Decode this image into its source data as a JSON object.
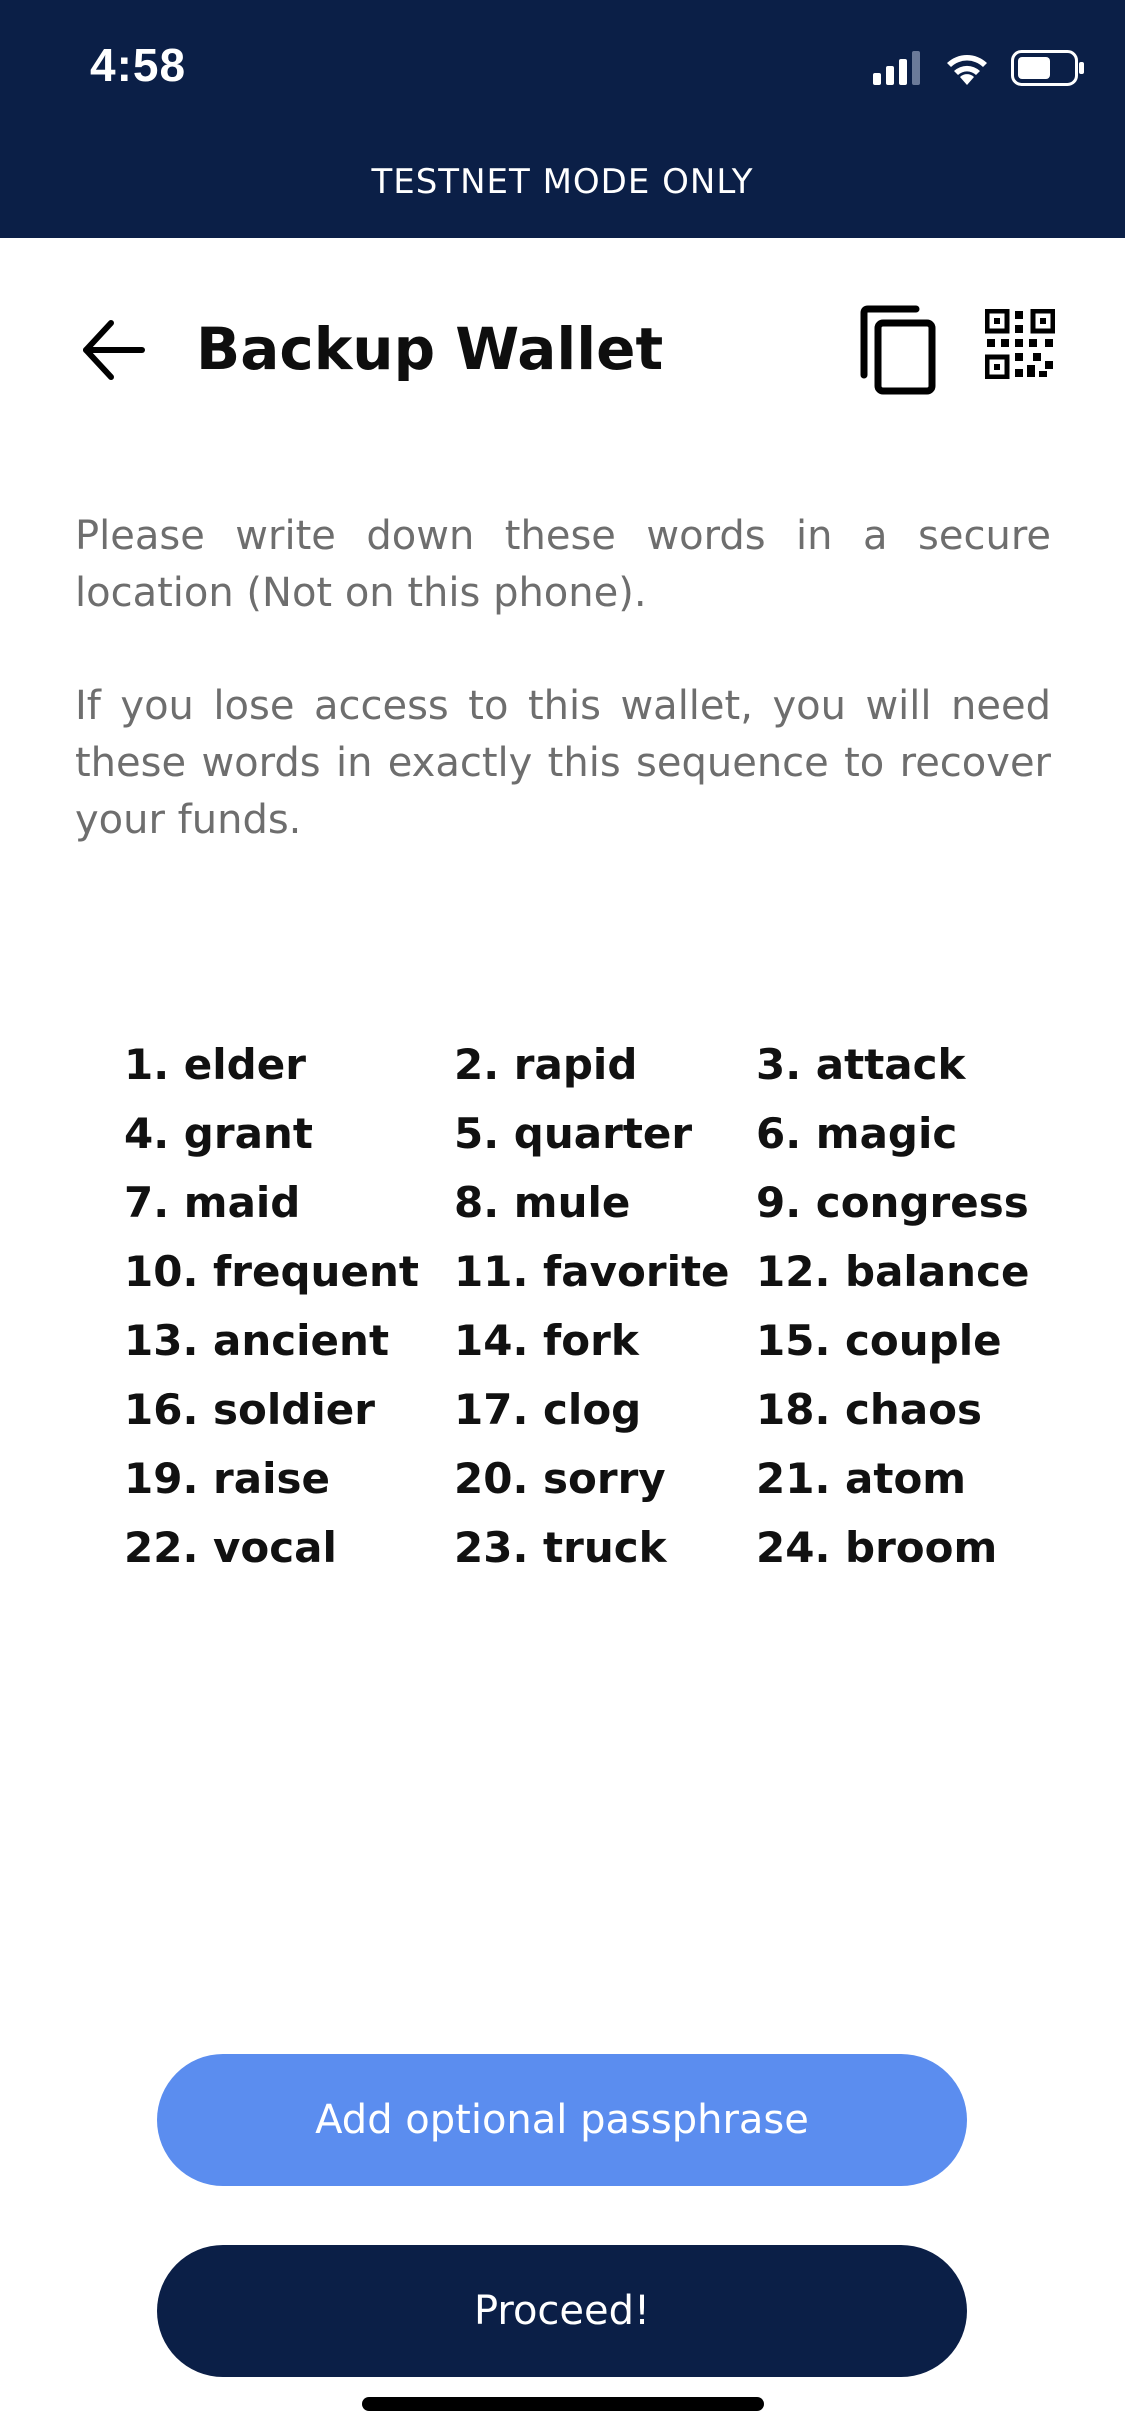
{
  "status_bar": {
    "time": "4:58",
    "banner": "TESTNET MODE ONLY",
    "signal_icon": "signal-icon",
    "wifi_icon": "wifi-icon",
    "battery_icon": "battery-icon"
  },
  "header": {
    "title": "Backup Wallet",
    "back_icon": "arrow-left-icon",
    "copy_icon": "copy-icon",
    "qr_icon": "qr-code-icon"
  },
  "instructions": {
    "paragraph1": "Please write down these words in a secure location (Not on this phone).",
    "paragraph2": "If you lose access to this wallet, you will need these words in exactly this sequence to recover your funds."
  },
  "words": [
    "1. elder",
    "2. rapid",
    "3. attack",
    "4. grant",
    "5. quarter",
    "6. magic",
    "7. maid",
    "8. mule",
    "9. congress",
    "10. frequent",
    "11. favorite",
    "12. balance",
    "13. ancient",
    "14. fork",
    "15. couple",
    "16. soldier",
    "17. clog",
    "18. chaos",
    "19. raise",
    "20. sorry",
    "21. atom",
    "22. vocal",
    "23. truck",
    "24. broom"
  ],
  "buttons": {
    "passphrase": "Add optional passphrase",
    "proceed": "Proceed!"
  },
  "colors": {
    "navy": "#0b1f47",
    "accent_blue": "#5b8def",
    "body_text": "#6e6e6e"
  }
}
